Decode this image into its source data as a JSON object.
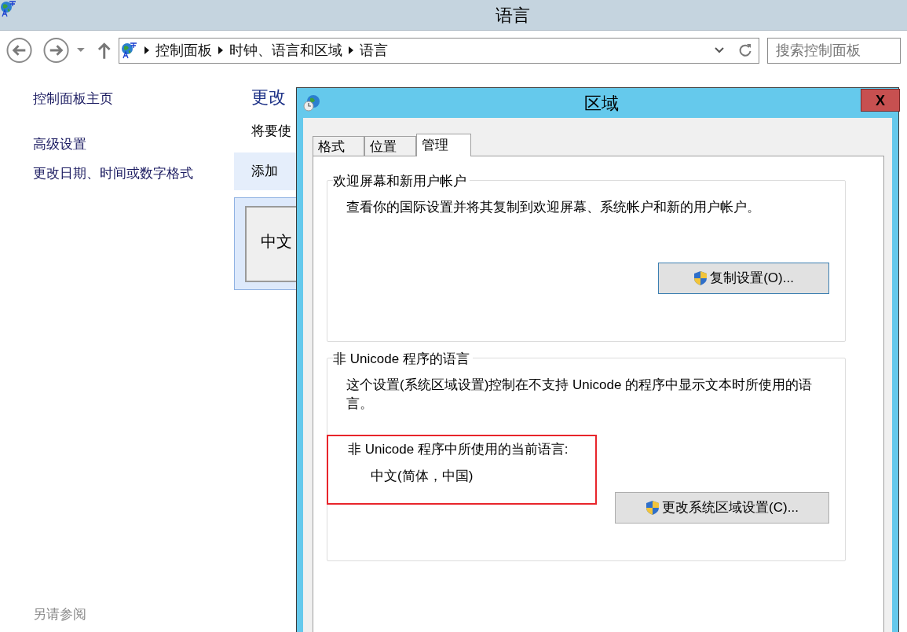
{
  "window": {
    "title": "语言"
  },
  "address_bar": {
    "breadcrumbs": [
      "控制面板",
      "时钟、语言和区域",
      "语言"
    ]
  },
  "search": {
    "placeholder": "搜索控制面板"
  },
  "sidebar": {
    "items": [
      "控制面板主页",
      "高级设置",
      "更改日期、时间或数字格式"
    ],
    "see_also": "另请参阅"
  },
  "content": {
    "heading": "更改",
    "description": "将要使",
    "add_language": "添加",
    "language_item": "中文"
  },
  "dialog": {
    "title": "区域",
    "close": "X",
    "tabs": [
      {
        "label": "格式",
        "selected": false
      },
      {
        "label": "位置",
        "selected": false
      },
      {
        "label": "管理",
        "selected": true
      }
    ],
    "groups": [
      {
        "title": "欢迎屏幕和新用户帐户",
        "text": "查看你的国际设置并将其复制到欢迎屏幕、系统帐户和新的用户帐户。",
        "button": "复制设置(O)..."
      },
      {
        "title": "非 Unicode 程序的语言",
        "text": "这个设置(系统区域设置)控制在不支持 Unicode 的程序中显示文本时所使用的语言。",
        "current_label": "非 Unicode 程序中所使用的当前语言:",
        "current_value": "中文(简体，中国)",
        "highlighted": true,
        "button": "更改系统区域设置(C)..."
      }
    ]
  }
}
